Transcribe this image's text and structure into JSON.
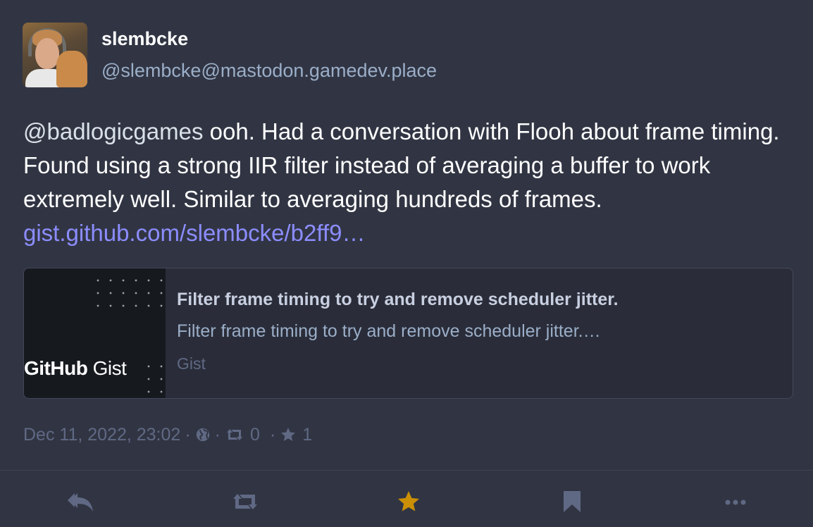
{
  "status": {
    "display_name": "slembcke",
    "acct": "@slembcke@mastodon.gamedev.place",
    "content": {
      "mention": "@badlogicgames",
      "text": " ooh. Had a conversation with Flooh about frame timing. Found using a strong IIR filter instead of averaging a buffer to work extremely well. Similar to averaging hundreds of frames. ",
      "link": "gist.github.com/slembcke/b2ff9…"
    },
    "card": {
      "logo_text_bold": "GitHub",
      "logo_text_light": " Gist",
      "title": "Filter frame timing to try and remove scheduler jitter.",
      "description": "Filter frame timing to try and remove scheduler jitter.…",
      "provider": "Gist"
    },
    "meta": {
      "date": "Dec 11, 2022, 23:02",
      "separator": "·",
      "visibility_icon": "globe-icon",
      "reblogs": "0",
      "favourites": "1"
    }
  },
  "actions": {
    "icons": [
      "reply-icon",
      "boost-icon",
      "star-icon",
      "bookmark-icon",
      "more-icon"
    ],
    "favourited_color": "#ca8f04"
  },
  "colors": {
    "background": "#313543",
    "link": "#8c8dff",
    "secondary": "#606984",
    "acct": "#9baec8"
  }
}
